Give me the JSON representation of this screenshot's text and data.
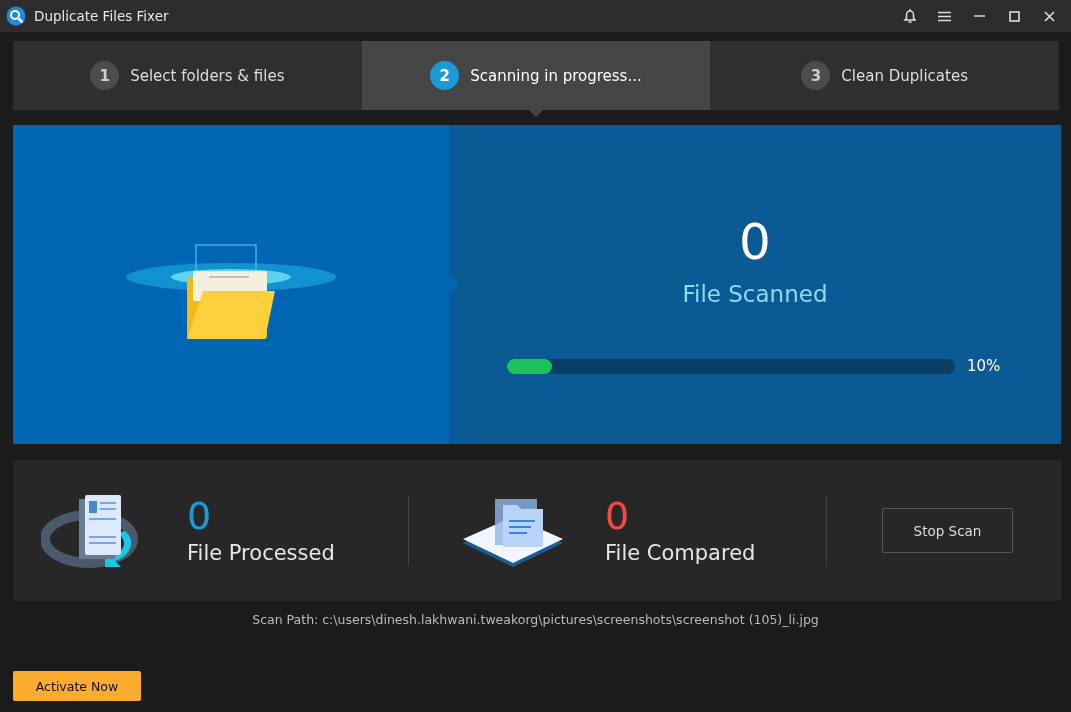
{
  "window": {
    "title": "Duplicate Files Fixer"
  },
  "steps": [
    {
      "number": "1",
      "label": "Select folders & files",
      "selected": false
    },
    {
      "number": "2",
      "label": "Scanning in progress...",
      "selected": true
    },
    {
      "number": "3",
      "label": "Clean Duplicates",
      "selected": false
    }
  ],
  "scan": {
    "count": "0",
    "label": "File Scanned",
    "level": 0.1,
    "reading": "10%"
  },
  "stats": [
    {
      "kind": "processed",
      "value": "0",
      "label": "File Processed",
      "color": "#1a9bd7"
    },
    {
      "kind": "compared",
      "value": "0",
      "label": "File Compared",
      "color": "#f04a45"
    }
  ],
  "stop_button": "Stop Scan",
  "scan_path": "Scan Path: c:\\users\\dinesh.lakhwani.tweakorg\\pictures\\screenshots\\screenshot (105)_li.jpg",
  "activate_button": "Activate Now"
}
